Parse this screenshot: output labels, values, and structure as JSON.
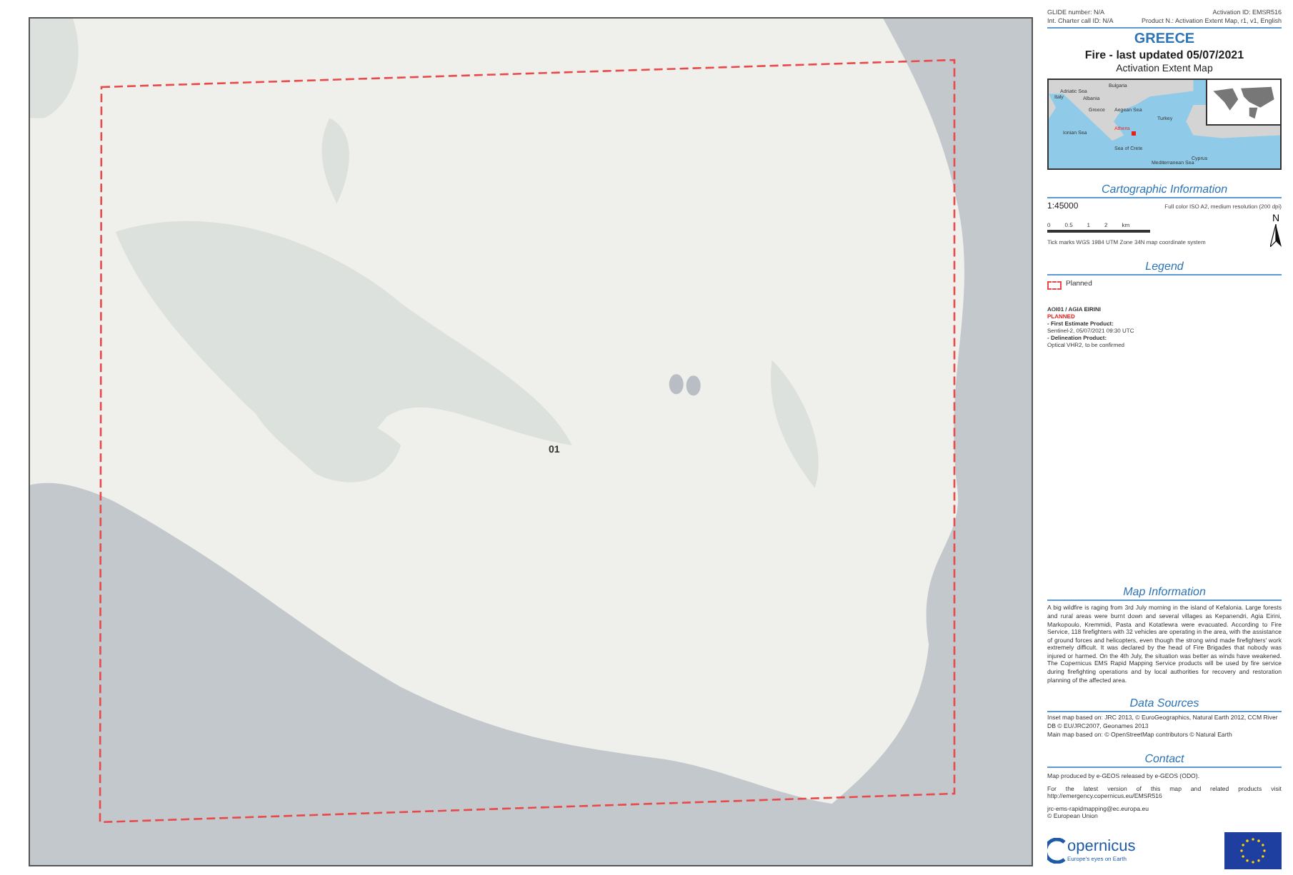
{
  "map": {
    "aoi_label": "01"
  },
  "header": {
    "glide": "GLIDE number: N/A",
    "activation": "Activation ID: EMSR516",
    "charter": "Int. Charter call ID: N/A",
    "product": "Product N.: Activation Extent Map, r1, v1, English"
  },
  "title": {
    "country": "GREECE",
    "event": "Fire - last updated 05/07/2021",
    "map_type": "Activation Extent Map"
  },
  "inset_labels": [
    "Adriatic Sea",
    "Bulgaria",
    "Italy",
    "Albania",
    "Greece",
    "Aegean Sea",
    "Turkey",
    "Ionian Sea",
    "Athens",
    "Sea of Crete",
    "Mediterranean Sea",
    "Cyprus"
  ],
  "cartographic": {
    "heading": "Cartographic Information",
    "scale": "1:45000",
    "print": "Full color ISO A2, medium resolution (200 dpi)",
    "scale_ticks": [
      "0",
      "0.5",
      "1",
      "2"
    ],
    "scale_unit": "km",
    "north": "N",
    "ticks_note": "Tick marks WGS 1984 UTM Zone 34N map coordinate system"
  },
  "legend": {
    "heading": "Legend",
    "items": [
      {
        "label": "Planned",
        "color": "#e8494a"
      }
    ],
    "aoi": "AOI01 / AGIA EIRINI",
    "status": "PLANNED",
    "lines": [
      "- First Estimate Product:",
      "Sentinel-2, 05/07/2021 09:30 UTC",
      "- Delineation Product:",
      "Optical VHR2, to be confirmed"
    ]
  },
  "map_information": {
    "heading": "Map Information",
    "text": "A big wildfire is raging from 3rd July morning in the island of Kefalonia. Large forests and rural areas were burnt down and several villages as Kepanendri, Agia Eirini, Markopoulo, Kremmidi, Pasta and Kotatlewra were evacuated. According to Fire Service, 118 firefighters with 32 vehicles are operating in the area, with the assistance of ground forces and helicopters, even though the strong wind made firefighters' work extremely difficult. It was declared by the head of Fire Brigades that nobody was injured or harmed. On the 4th July, the situation was better as winds have weakened. The Copernicus EMS Rapid Mapping Service products will be used by fire service during firefighting operations and by local authorities for recovery and restoration planning of the affected area."
  },
  "data_sources": {
    "heading": "Data Sources",
    "lines": [
      "Inset map based on: JRC 2013, © EuroGeographics, Natural Earth 2012, CCM River DB © EU/JRC2007, Geonames 2013",
      "Main map based on: © OpenStreetMap contributors © Natural Earth"
    ]
  },
  "contact": {
    "heading": "Contact",
    "paragraphs": [
      "Map produced by e-GEOS released by e-GEOS (ODO).",
      "For the latest version of this map and related products visit http://emergency.copernicus.eu/EMSR516",
      "jrc-ems-rapidmapping@ec.europa.eu\n© European Union"
    ]
  },
  "logo": {
    "name": "opernicus",
    "tagline": "Europe's eyes on Earth"
  }
}
